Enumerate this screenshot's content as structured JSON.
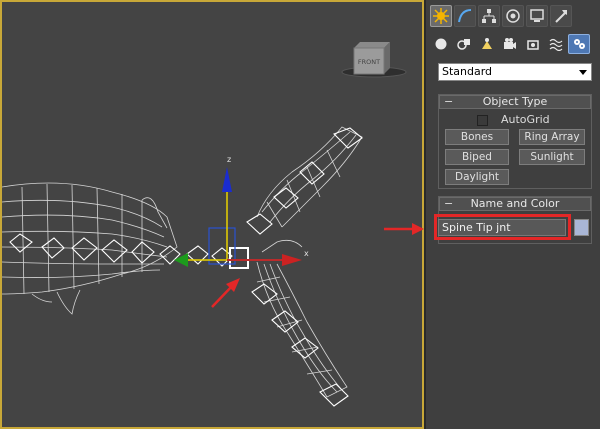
{
  "viewport": {
    "label": "FRONT",
    "gizmo_axis_x": "x",
    "gizmo_axis_z": "z"
  },
  "command_panel": {
    "tabs": [
      "create-icon",
      "modify-icon",
      "hierarchy-icon",
      "motion-icon",
      "display-icon",
      "utilities-icon"
    ],
    "subtabs": [
      "geometry-icon",
      "shapes-icon",
      "lights-icon",
      "cameras-icon",
      "helpers-icon",
      "spacewarps-icon",
      "systems-icon"
    ],
    "category_dropdown": "Standard",
    "object_type": {
      "title": "Object Type",
      "minus": "−",
      "autogrid": "AutoGrid",
      "buttons": [
        "Bones",
        "Ring Array",
        "Biped",
        "Sunlight",
        "Daylight"
      ]
    },
    "name_and_color": {
      "title": "Name and Color",
      "minus": "−",
      "name_value": "Spine Tip jnt"
    }
  },
  "colors": {
    "highlight": "#e32727",
    "swatch": "#a9b6d6",
    "active_subtab": "#4e78b4"
  }
}
